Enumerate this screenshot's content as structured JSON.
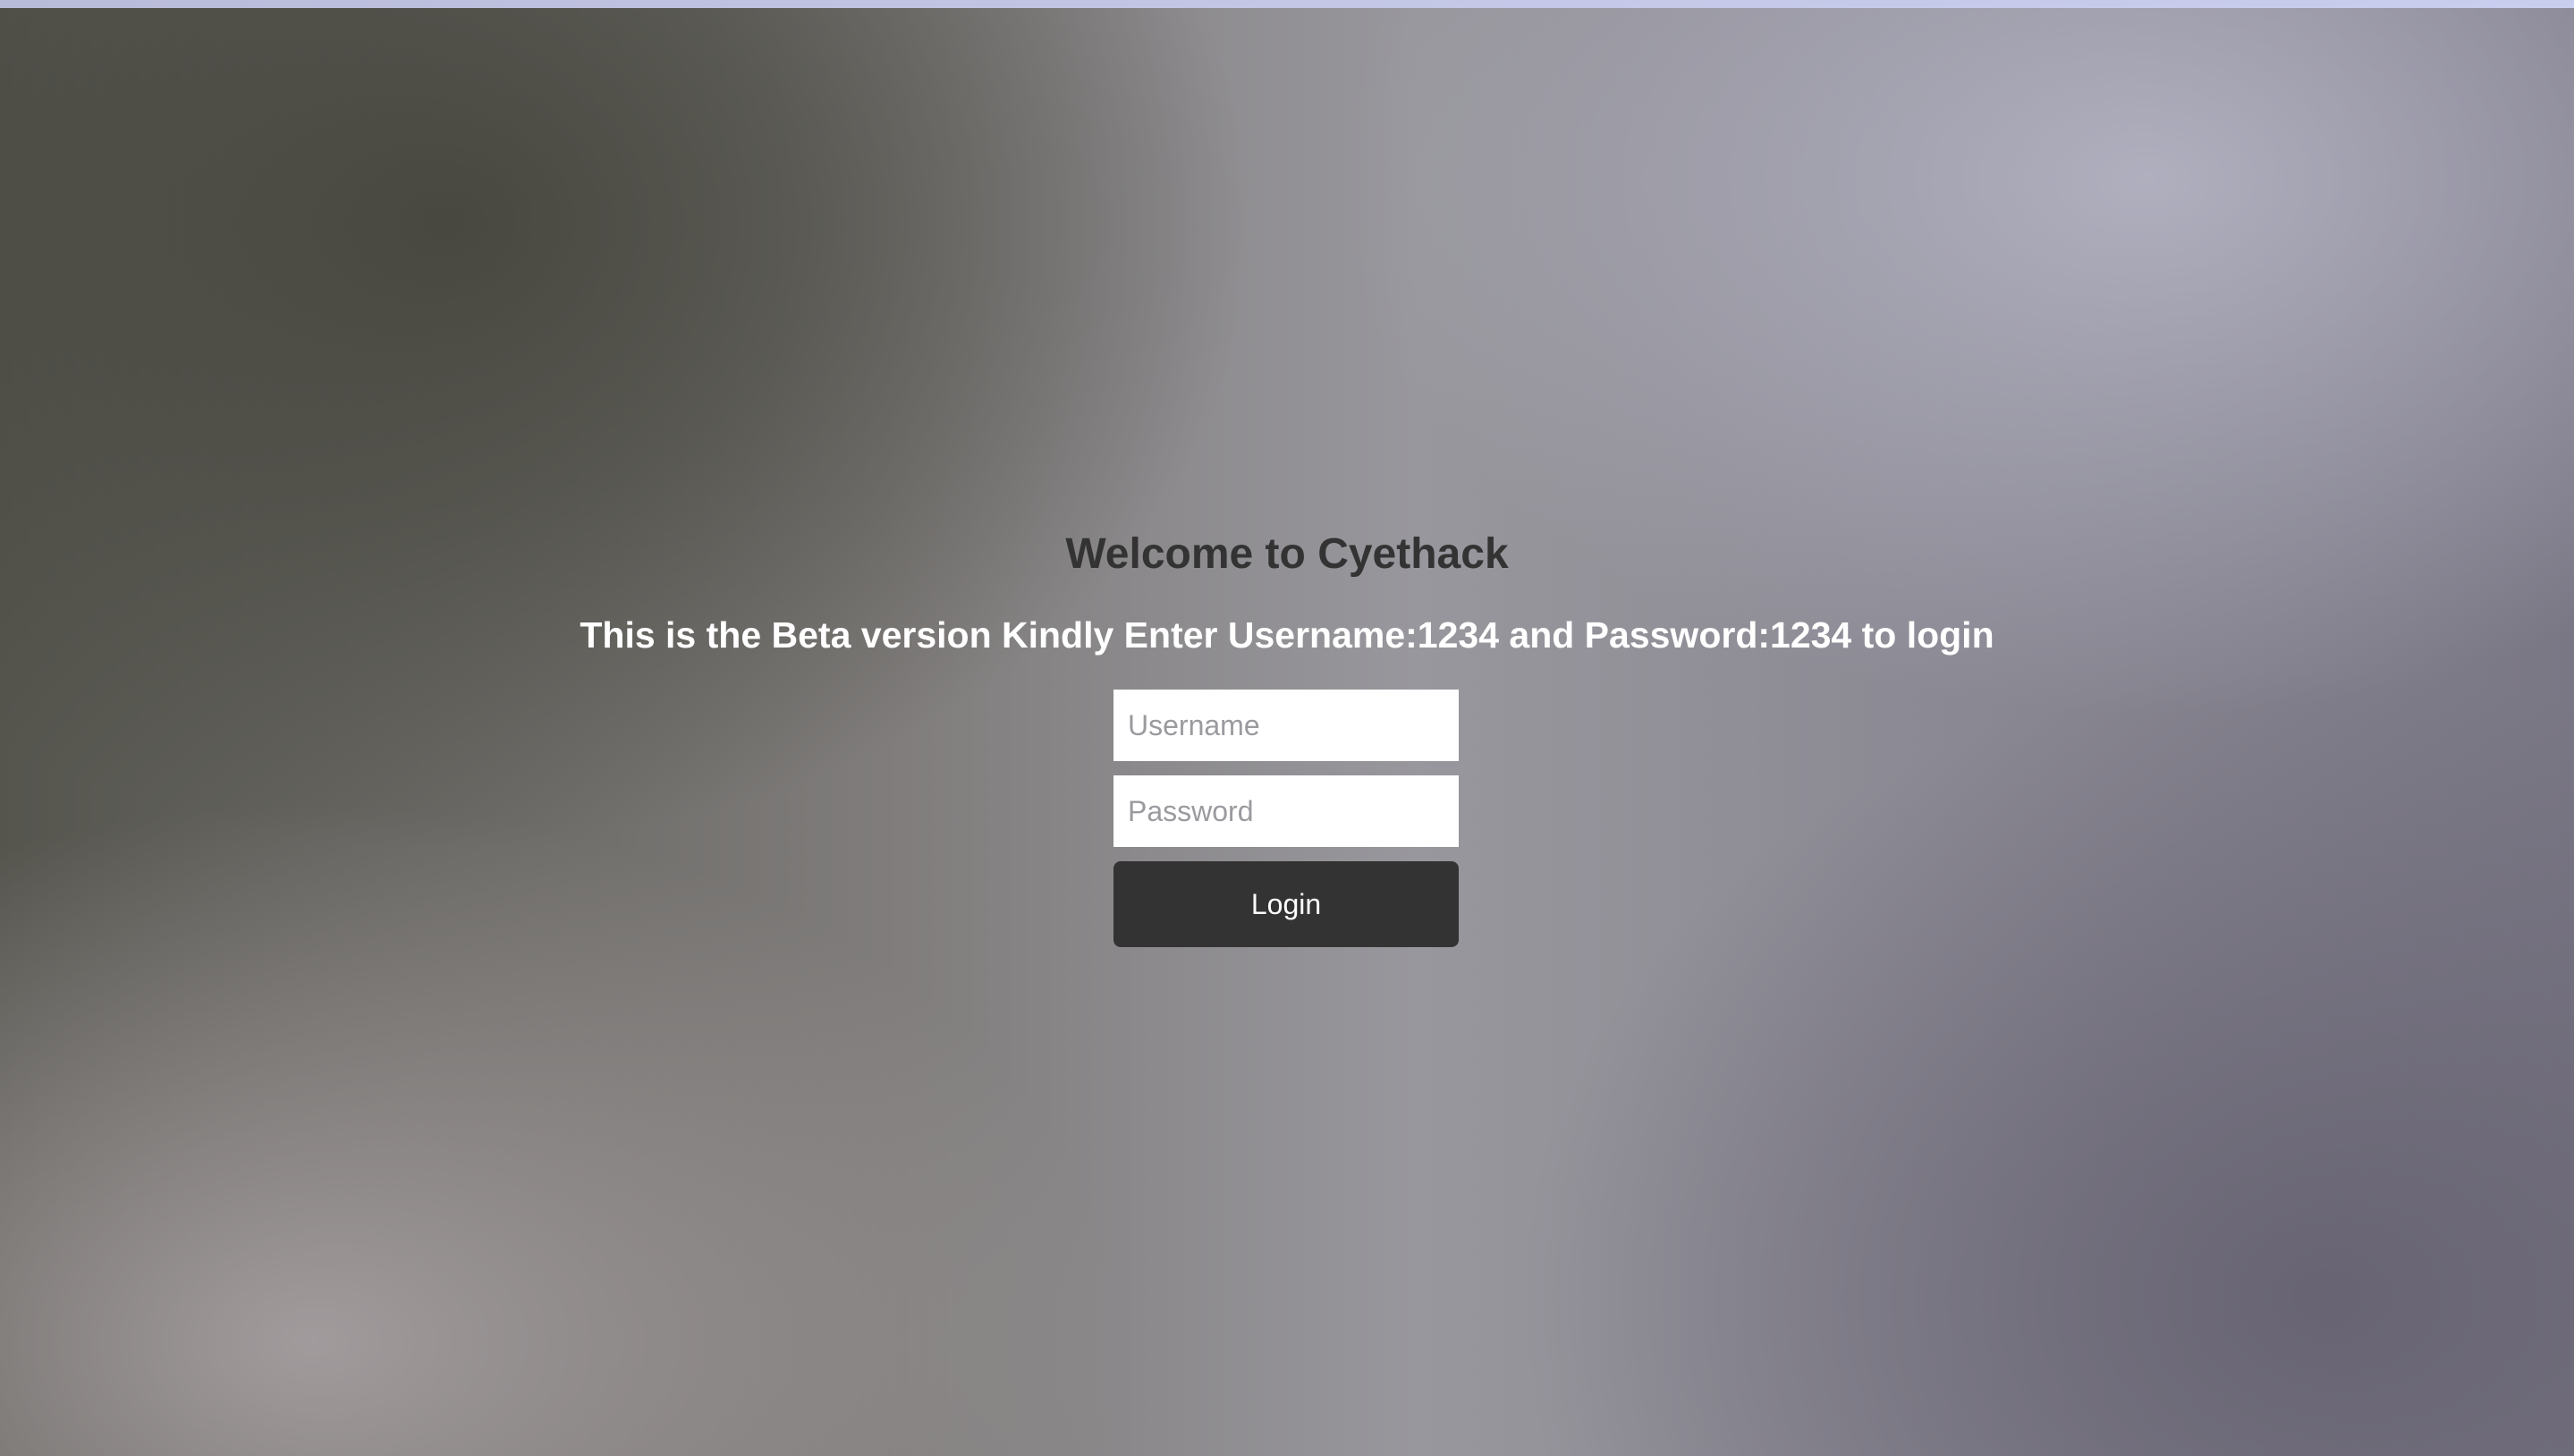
{
  "login": {
    "title": "Welcome to Cyethack",
    "subtitle": "This is the Beta version Kindly Enter Username:1234 and Password:1234 to login",
    "username_placeholder": "Username",
    "username_value": "",
    "password_placeholder": "Password",
    "password_value": "",
    "button_label": "Login"
  },
  "colors": {
    "title": "#333333",
    "subtitle": "#ffffff",
    "button_bg": "#333333",
    "button_text": "#ffffff",
    "input_bg": "#ffffff",
    "top_strip": "#c4c7e6"
  }
}
